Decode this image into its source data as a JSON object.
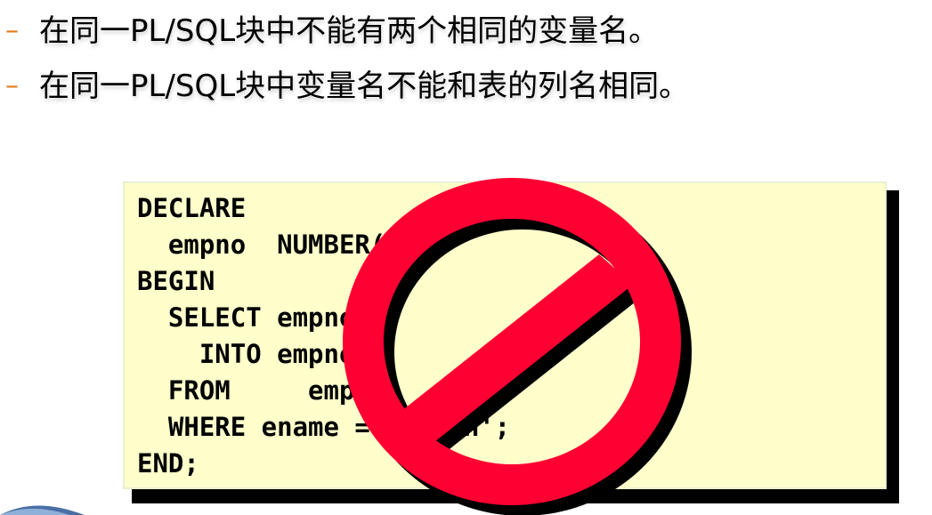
{
  "bullets": [
    {
      "marker": "–",
      "text": "在同一PL/SQL块中不能有两个相同的变量名。"
    },
    {
      "marker": "–",
      "text": "在同一PL/SQL块中变量名不能和表的列名相同。"
    }
  ],
  "code_lines": [
    "DECLARE",
    "  empno  NUMBER(4);",
    "BEGIN",
    "  SELECT empno",
    "    INTO empno",
    "  FROM     emp",
    "  WHERE ename = 'SMITH';",
    "END;"
  ],
  "icons": {
    "prohibition": "prohibition-icon"
  },
  "colors": {
    "bullet_marker": "#e07b1c",
    "code_background": "#ffffcc",
    "prohibition_red": "#ff0033",
    "shadow": "#000000"
  }
}
